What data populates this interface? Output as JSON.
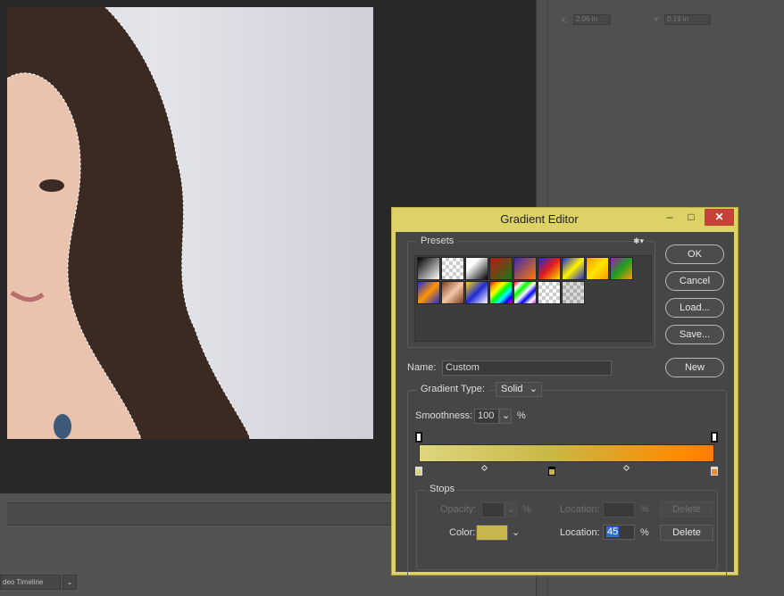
{
  "background": {
    "x_label": "X:",
    "x_value": "2.06 in",
    "y_label": "Y:",
    "y_value": "0.19 in",
    "timeline_label": "deo Timeline",
    "timeline_dropdown": "⌄"
  },
  "dialog": {
    "title": "Gradient Editor",
    "minimize": "–",
    "maximize": "□",
    "close": "✕",
    "presets_label": "Presets",
    "presets_menu_icon": "gear-icon",
    "presets_menu_glyph": "✱▾",
    "buttons": {
      "ok": "OK",
      "cancel": "Cancel",
      "load": "Load...",
      "save": "Save...",
      "new": "New"
    },
    "name_label": "Name:",
    "name_value": "Custom",
    "gradient_type_label": "Gradient Type:",
    "gradient_type_value": "Solid",
    "smoothness_label": "Smoothness:",
    "smoothness_value": "100",
    "smoothness_unit": "%",
    "gradient": {
      "colors": [
        "#ded67f",
        "#c8b845",
        "#ff8a00",
        "#ff7b00"
      ],
      "color_stops_percent": [
        0,
        45,
        100
      ],
      "opacity_stops_percent": [
        0,
        100
      ],
      "midpoints_percent": [
        22,
        70
      ]
    },
    "stops": {
      "legend": "Stops",
      "opacity_label": "Opacity:",
      "opacity_unit": "%",
      "location_label_1": "Location:",
      "location_unit_1": "%",
      "delete_1": "Delete",
      "color_label": "Color:",
      "color_swatch": "#c8b64d",
      "location_label_2": "Location:",
      "location_value": "45",
      "location_unit_2": "%",
      "delete_2": "Delete"
    }
  },
  "colors": {
    "dialog_frame": "#dcd266",
    "close_button": "#c7413a",
    "dialog_body": "#464646"
  }
}
